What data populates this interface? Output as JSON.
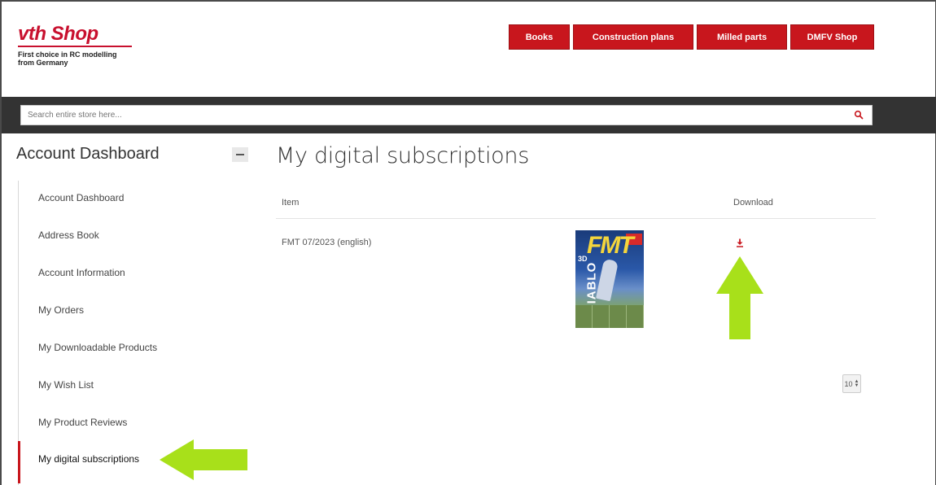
{
  "header": {
    "logo": {
      "mark_vth": "vth",
      "mark_shop": "Shop",
      "tagline_line1": "First choice in RC modelling",
      "tagline_line2": "from Germany"
    },
    "nav": [
      {
        "label": "Books"
      },
      {
        "label": "Construction plans"
      },
      {
        "label": "Milled parts"
      },
      {
        "label": "DMFV Shop"
      }
    ],
    "accent_color": "#c8161d"
  },
  "search": {
    "placeholder": "Search entire store here..."
  },
  "sidebar": {
    "title": "Account Dashboard",
    "items": [
      {
        "label": "Account Dashboard"
      },
      {
        "label": "Address Book"
      },
      {
        "label": "Account Information"
      },
      {
        "label": "My Orders"
      },
      {
        "label": "My Downloadable Products"
      },
      {
        "label": "My Wish List"
      },
      {
        "label": "My Product Reviews"
      },
      {
        "label": "My digital subscriptions",
        "active": true
      }
    ]
  },
  "main": {
    "title": "My digital subscriptions",
    "columns": {
      "item": "Item",
      "download": "Download"
    },
    "rows": [
      {
        "item": "FMT 07/2023 (english)",
        "cover": {
          "title": "FMT",
          "side_text": "DIABLO",
          "badge": "3D"
        }
      }
    ],
    "pager": {
      "selected": "10"
    }
  },
  "annotations": {
    "arrow_color": "#a8e01a"
  }
}
